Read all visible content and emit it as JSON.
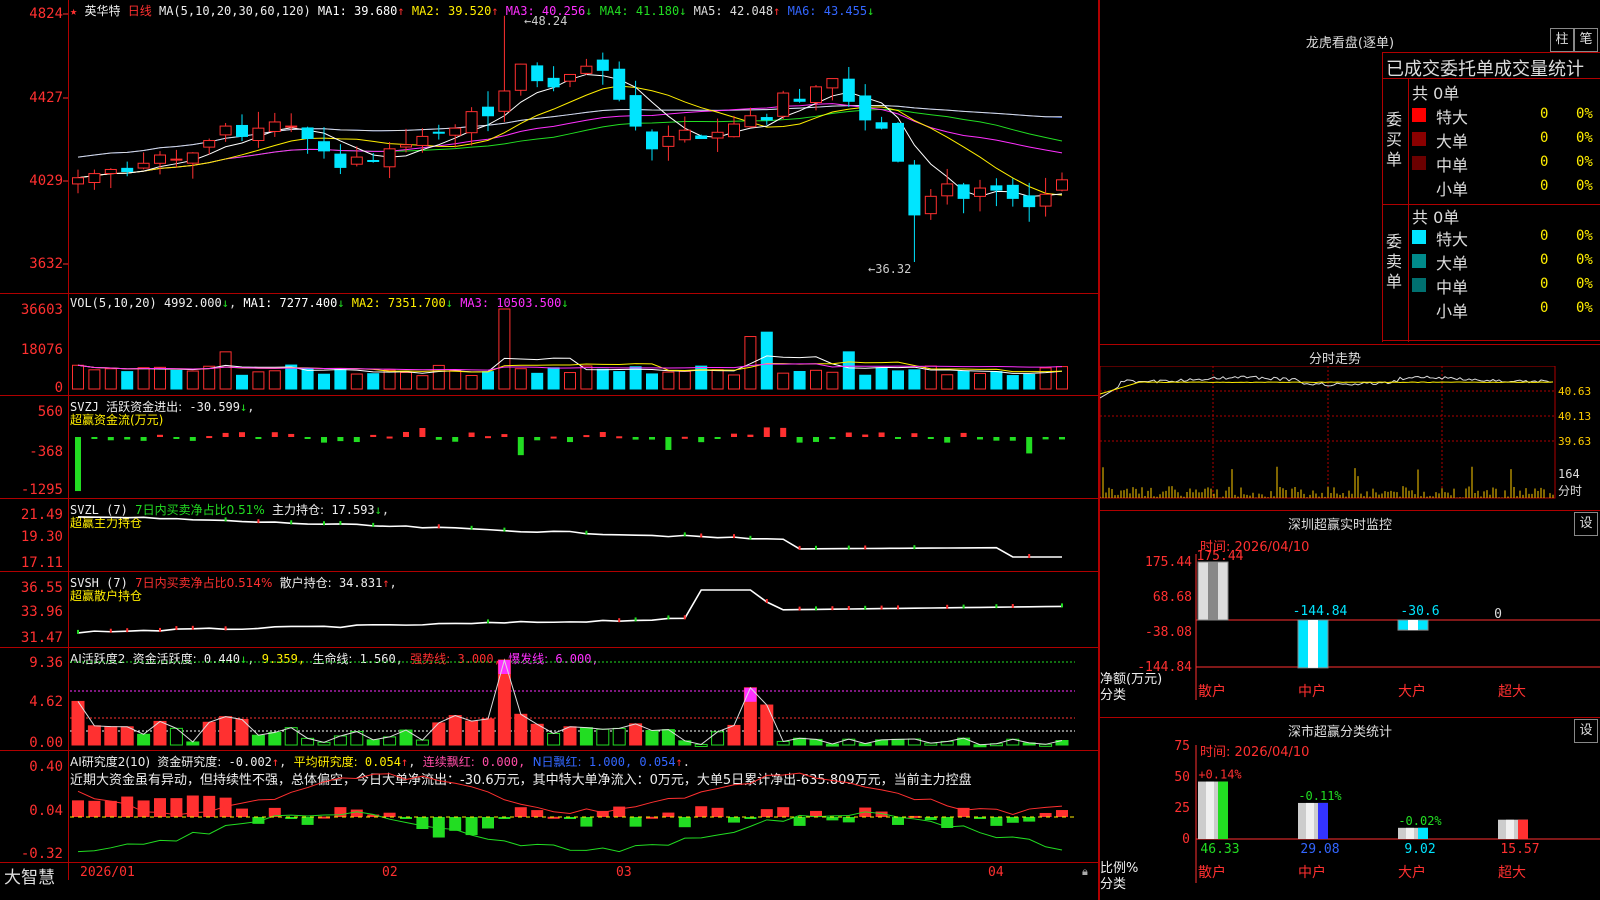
{
  "main": {
    "star": "★",
    "name": "英华特",
    "period": "日线",
    "ma_def": "MA(5,10,20,30,60,120)",
    "ma": [
      {
        "label": "MA1:",
        "value": "39.680",
        "arrow": "↑",
        "color": "#ffffff"
      },
      {
        "label": "MA2:",
        "value": "39.520",
        "arrow": "↑",
        "color": "#ffee00"
      },
      {
        "label": "MA3:",
        "value": "40.256",
        "arrow": "↓",
        "color": "#ff30ff"
      },
      {
        "label": "MA4:",
        "value": "41.180",
        "arrow": "↓",
        "color": "#22dd22"
      },
      {
        "label": "MA5:",
        "value": "42.048",
        "arrow": "↑",
        "color": "#dddddd"
      },
      {
        "label": "MA6:",
        "value": "43.455",
        "arrow": "↓",
        "color": "#3366ff"
      }
    ],
    "y_labels": [
      "4824",
      "4427",
      "4029",
      "3632"
    ],
    "high_annot": "48.24",
    "low_annot": "36.32"
  },
  "vol": {
    "def": "VOL(5,10,20)",
    "value": "4992.000",
    "ma": [
      {
        "label": "MA1:",
        "value": "7277.400",
        "color": "#ffffff"
      },
      {
        "label": "MA2:",
        "value": "7351.700",
        "color": "#ffee00"
      },
      {
        "label": "MA3:",
        "value": "10503.500",
        "color": "#ff30ff"
      }
    ],
    "y_labels": [
      "36603",
      "18076",
      "0"
    ]
  },
  "svzj": {
    "def": "SVZJ",
    "label": "活跃资金进出:",
    "value": "-30.599",
    "sub": "超赢资金流(万元)",
    "y_labels": [
      "560",
      "-368",
      "-1295"
    ]
  },
  "svzl": {
    "def": "SVZL (7)",
    "txt": "7日内买卖净占比0.51%",
    "label": "主力持仓:",
    "value": "17.593",
    "sub": "超赢主力持仓",
    "y_labels": [
      "21.49",
      "19.30",
      "17.11"
    ]
  },
  "svsh": {
    "def": "SVSH (7)",
    "txt": "7日内买卖净占比0.514%",
    "label": "散户持仓:",
    "value": "34.831",
    "sub": "超赢散户持仓",
    "y_labels": [
      "36.55",
      "33.96",
      "31.47"
    ]
  },
  "ai2": {
    "def": "AI活跃度2",
    "l1": "资金活跃度:",
    "v1": "0.440",
    "v2": "9.359,",
    "l3": "生命线:",
    "v3": "1.560,",
    "l4": "强势线:",
    "v4": "3.000,",
    "l5": "爆发线:",
    "v5": "6.000,",
    "y_labels": [
      "9.36",
      "4.62",
      "0.00"
    ]
  },
  "ai_res": {
    "def": "AI研究度2(10)",
    "l1": "资金研究度:",
    "v1": "-0.002",
    "l2": "平均研究度:",
    "v2": "0.054",
    "l3": "连续飘红:",
    "v3": "0.000,",
    "l4": "N日飘红:",
    "v4": "1.000,",
    "v5": "0.054",
    "text": "近期大资金虽有异动，但持续性不强，总体偏空，今日大单净流出：-30.6万元，其中特大单净流入：0万元，大单5日累计净出-635.809万元，当前主力控盘",
    "y_labels": [
      "0.40",
      "0.04",
      "-0.32"
    ]
  },
  "x_axis": [
    "2026/01",
    "02",
    "03",
    "04"
  ],
  "brand": "大智慧",
  "dragon": {
    "title": "龙虎看盘(逐单)",
    "btn1": "柱",
    "btn2": "笔",
    "sub": "已成交委托单成交量统计",
    "buy_label": "委买单",
    "sell_label": "委卖单",
    "buy_total": "共 0单",
    "sell_total": "共 0单",
    "buy_rows": [
      {
        "name": "特大",
        "count": "0",
        "pct": "0%",
        "color": "#ff0000"
      },
      {
        "name": "大单",
        "count": "0",
        "pct": "0%",
        "color": "#8b0000"
      },
      {
        "name": "中单",
        "count": "0",
        "pct": "0%",
        "color": "#6b0000"
      },
      {
        "name": "小单",
        "count": "0",
        "pct": "0%",
        "color": "#000000"
      }
    ],
    "sell_rows": [
      {
        "name": "特大",
        "count": "0",
        "pct": "0%",
        "color": "#00e5ff"
      },
      {
        "name": "大单",
        "count": "0",
        "pct": "0%",
        "color": "#008b8b"
      },
      {
        "name": "中单",
        "count": "0",
        "pct": "0%",
        "color": "#007070"
      },
      {
        "name": "小单",
        "count": "0",
        "pct": "0%",
        "color": "#000000"
      }
    ]
  },
  "intraday": {
    "title": "分时走势",
    "y_labels": [
      "40.63",
      "40.13",
      "39.63"
    ],
    "vol_labels": [
      "164",
      "分时"
    ]
  },
  "sz_monitor": {
    "title": "深圳超赢实时监控",
    "btn": "设",
    "time": "时间: 2026/04/10",
    "y_labels": [
      "175.44",
      "68.68",
      "-38.08",
      "-144.84"
    ],
    "unit": "净额(万元)",
    "cat_label": "分类",
    "values": [
      "175.44",
      "-144.84",
      "-30.6",
      "0"
    ],
    "cats": [
      "散户",
      "中户",
      "大户",
      "超大"
    ]
  },
  "sz_stats": {
    "title": "深市超赢分类统计",
    "btn": "设",
    "time": "时间: 2026/04/10",
    "y_labels": [
      "75",
      "50",
      "25",
      "0"
    ],
    "unit": "比例%",
    "cat_label": "分类",
    "changes": [
      "+0.14%",
      "-0.11%",
      "-0.02%",
      ""
    ],
    "values": [
      "46.33",
      "29.08",
      "9.02",
      "15.57"
    ],
    "cats": [
      "散户",
      "中户",
      "大户",
      "超大"
    ]
  }
}
